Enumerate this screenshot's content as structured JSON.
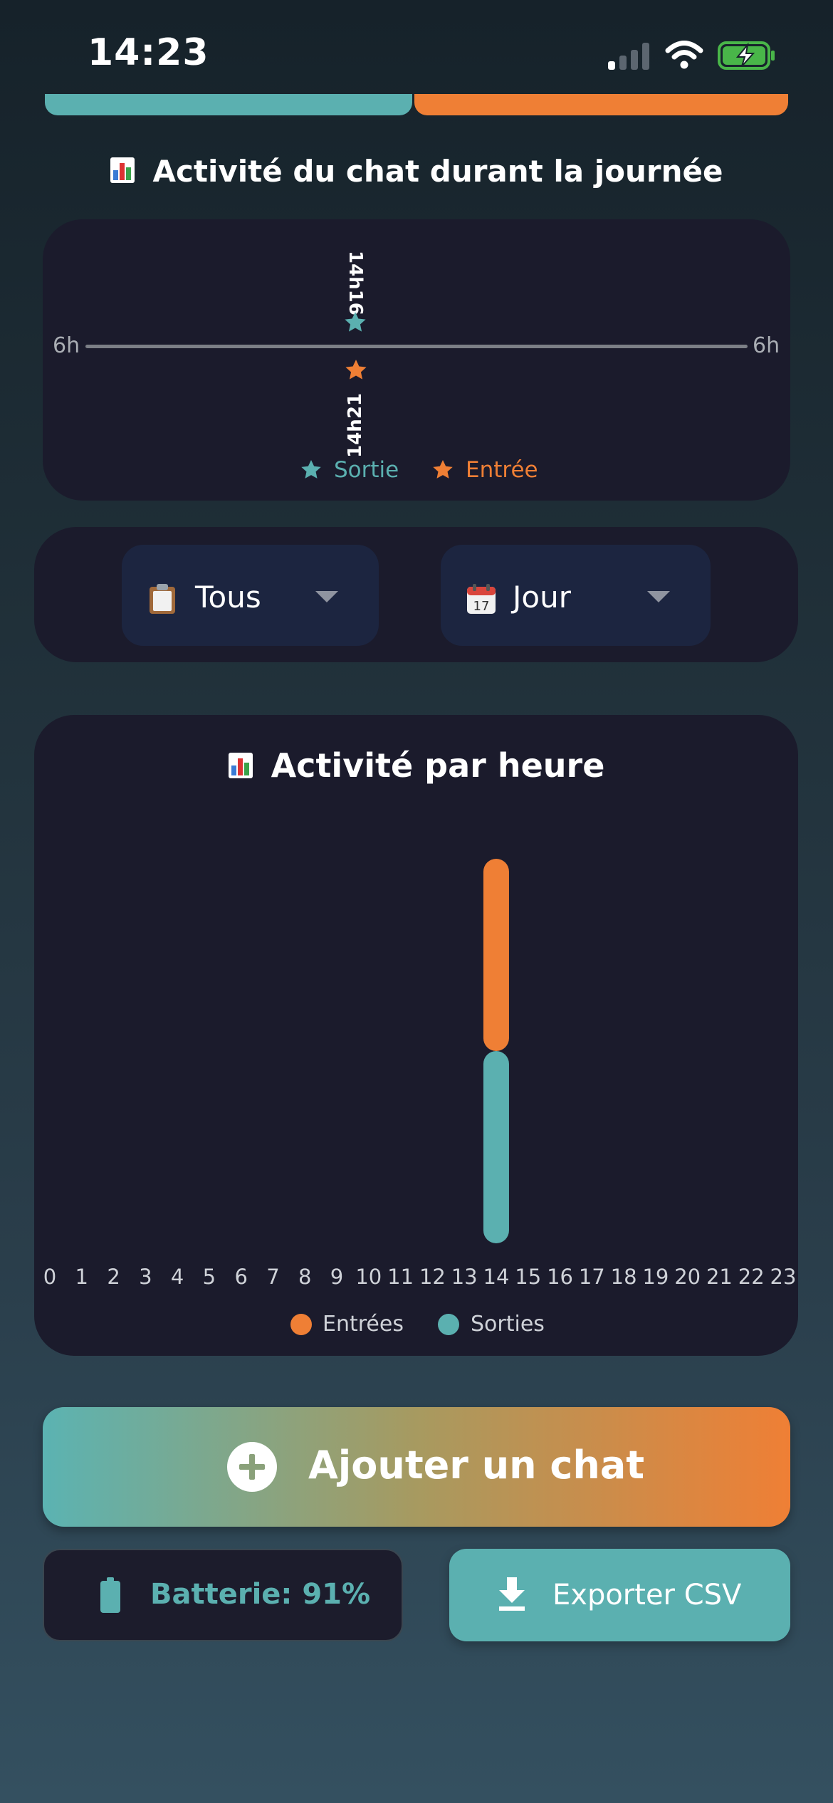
{
  "status_bar": {
    "time": "14:23"
  },
  "timeline": {
    "title": "Activité du chat durant la journée",
    "left_label": "6h",
    "right_label": "6h",
    "events": [
      {
        "type": "Sortie",
        "time": "14h16",
        "color": "#5bb0b0"
      },
      {
        "type": "Entrée",
        "time": "14h21",
        "color": "#ef7f35"
      }
    ],
    "legend": [
      {
        "label": "Sortie",
        "color": "#5bb0b0",
        "icon": "star-icon"
      },
      {
        "label": "Entrée",
        "color": "#ef7f35",
        "icon": "star-icon"
      }
    ]
  },
  "filters": {
    "filter_select": {
      "icon": "clipboard-icon",
      "value": "Tous"
    },
    "period_select": {
      "icon": "calendar-icon",
      "value": "Jour"
    }
  },
  "hourly_chart": {
    "title": "Activité par heure"
  },
  "chart_data": {
    "type": "bar",
    "stacked": true,
    "title": "Activité par heure",
    "categories": [
      "0",
      "1",
      "2",
      "3",
      "4",
      "5",
      "6",
      "7",
      "8",
      "9",
      "10",
      "11",
      "12",
      "13",
      "14",
      "15",
      "16",
      "17",
      "18",
      "19",
      "20",
      "21",
      "22",
      "23"
    ],
    "series": [
      {
        "name": "Sorties",
        "color": "#5bb0b0",
        "values": [
          0,
          0,
          0,
          0,
          0,
          0,
          0,
          0,
          0,
          0,
          0,
          0,
          0,
          0,
          1,
          0,
          0,
          0,
          0,
          0,
          0,
          0,
          0,
          0
        ]
      },
      {
        "name": "Entrées",
        "color": "#ef7f35",
        "values": [
          0,
          0,
          0,
          0,
          0,
          0,
          0,
          0,
          0,
          0,
          0,
          0,
          0,
          0,
          1,
          0,
          0,
          0,
          0,
          0,
          0,
          0,
          0,
          0
        ]
      }
    ],
    "legend": [
      {
        "label": "Entrées",
        "color": "#ef7f35"
      },
      {
        "label": "Sorties",
        "color": "#5bb0b0"
      }
    ],
    "legend_position": "bottom",
    "grid": false
  },
  "actions": {
    "add_cat": "Ajouter un chat",
    "battery": "Batterie: 91%",
    "export": "Exporter CSV"
  },
  "colors": {
    "accent_teal": "#5bb0b0",
    "accent_orange": "#ef7f35",
    "card_bg": "#1b1b2c"
  }
}
